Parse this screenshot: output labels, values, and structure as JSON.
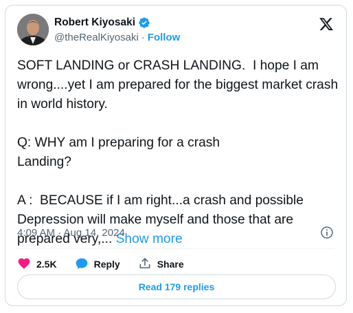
{
  "author": {
    "name": "Robert Kiyosaki",
    "handle": "@theRealKiyosaki",
    "separator": "·",
    "follow_label": "Follow"
  },
  "tweet": {
    "text": "SOFT LANDING or CRASH LANDING.  I hope I am wrong....yet I am prepared for the biggest market crash in world history.\n\nQ: WHY am I preparing for a crash\nLanding?\n\nA :  BECAUSE if I am right...a crash and possible Depression will make myself and those that are prepared very,... ",
    "show_more": "Show more",
    "timestamp": "4:09 AM · Aug 14, 2024"
  },
  "actions": {
    "likes": "2.5K",
    "reply_label": "Reply",
    "share_label": "Share"
  },
  "replies_button": "Read 179 replies",
  "colors": {
    "accent": "#1d9bf0",
    "like": "#f91880",
    "muted": "#536471",
    "border": "#cfd9de"
  },
  "icons": [
    "verified-badge-icon",
    "x-logo-icon",
    "info-icon",
    "heart-icon",
    "reply-bubble-icon",
    "share-icon"
  ]
}
